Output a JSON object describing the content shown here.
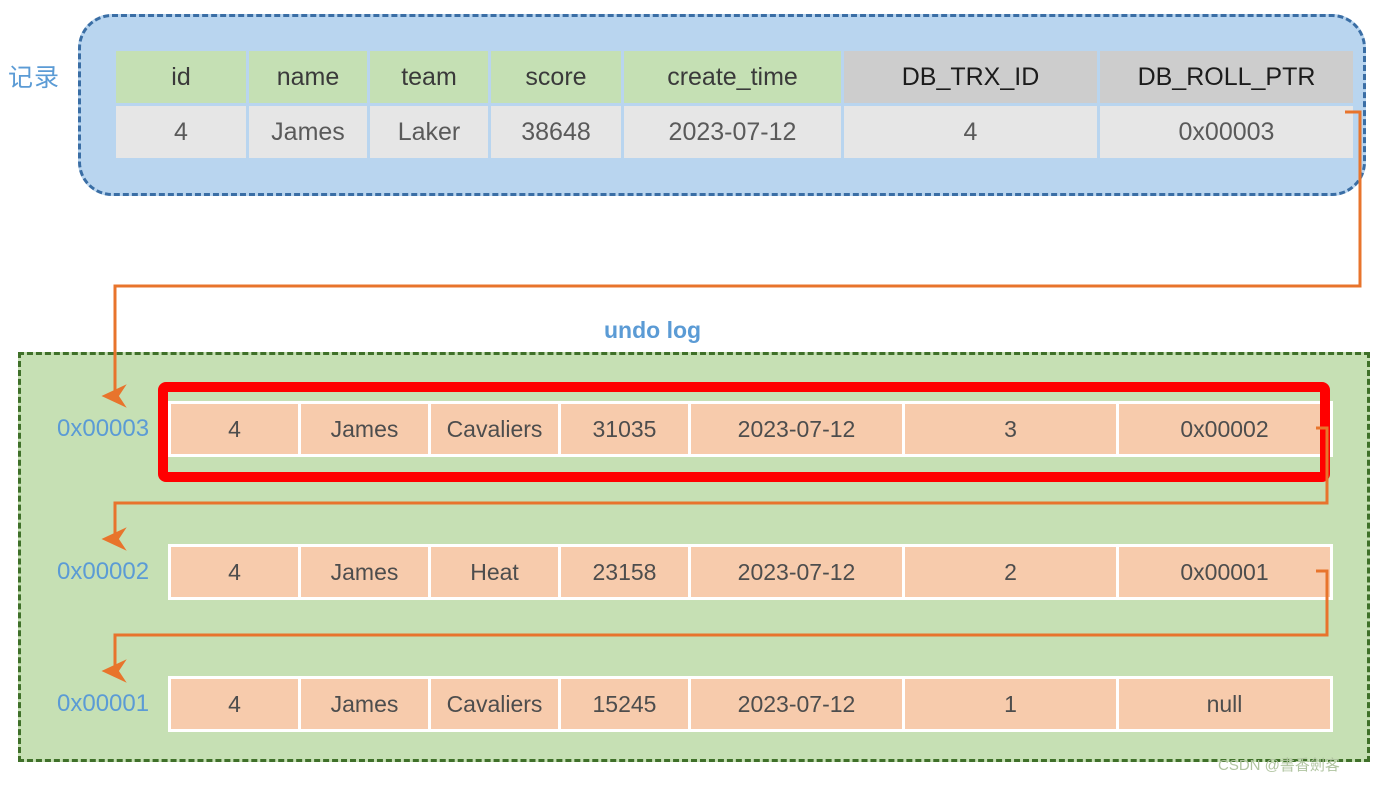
{
  "labels": {
    "record": "记录",
    "undo_log": "undo log",
    "watermark": "CSDN @書香劍客"
  },
  "colors": {
    "record_box_fill": "#b9d5ef",
    "record_box_border": "#3a6ea5",
    "header_green": "#c5e0b4",
    "header_gray": "#cdcdcd",
    "row_gray": "#e6e6e6",
    "undo_box_fill": "#c6e0b4",
    "undo_box_border": "#3f7029",
    "undo_cell": "#f7cbac",
    "accent_blue": "#5b9bd5",
    "connector_orange": "#e8742c",
    "highlight_red": "#ff0000"
  },
  "record_table": {
    "headers": [
      "id",
      "name",
      "team",
      "score",
      "create_time",
      "DB_TRX_ID",
      "DB_ROLL_PTR"
    ],
    "row": [
      "4",
      "James",
      "Laker",
      "38648",
      "2023-07-12",
      "4",
      "0x00003"
    ]
  },
  "undo_log": {
    "entries": [
      {
        "pointer": "0x00003",
        "highlighted": true,
        "cells": [
          "4",
          "James",
          "Cavaliers",
          "31035",
          "2023-07-12",
          "3",
          "0x00002"
        ]
      },
      {
        "pointer": "0x00002",
        "highlighted": false,
        "cells": [
          "4",
          "James",
          "Heat",
          "23158",
          "2023-07-12",
          "2",
          "0x00001"
        ]
      },
      {
        "pointer": "0x00001",
        "highlighted": false,
        "cells": [
          "4",
          "James",
          "Cavaliers",
          "15245",
          "2023-07-12",
          "1",
          "null"
        ]
      }
    ]
  }
}
